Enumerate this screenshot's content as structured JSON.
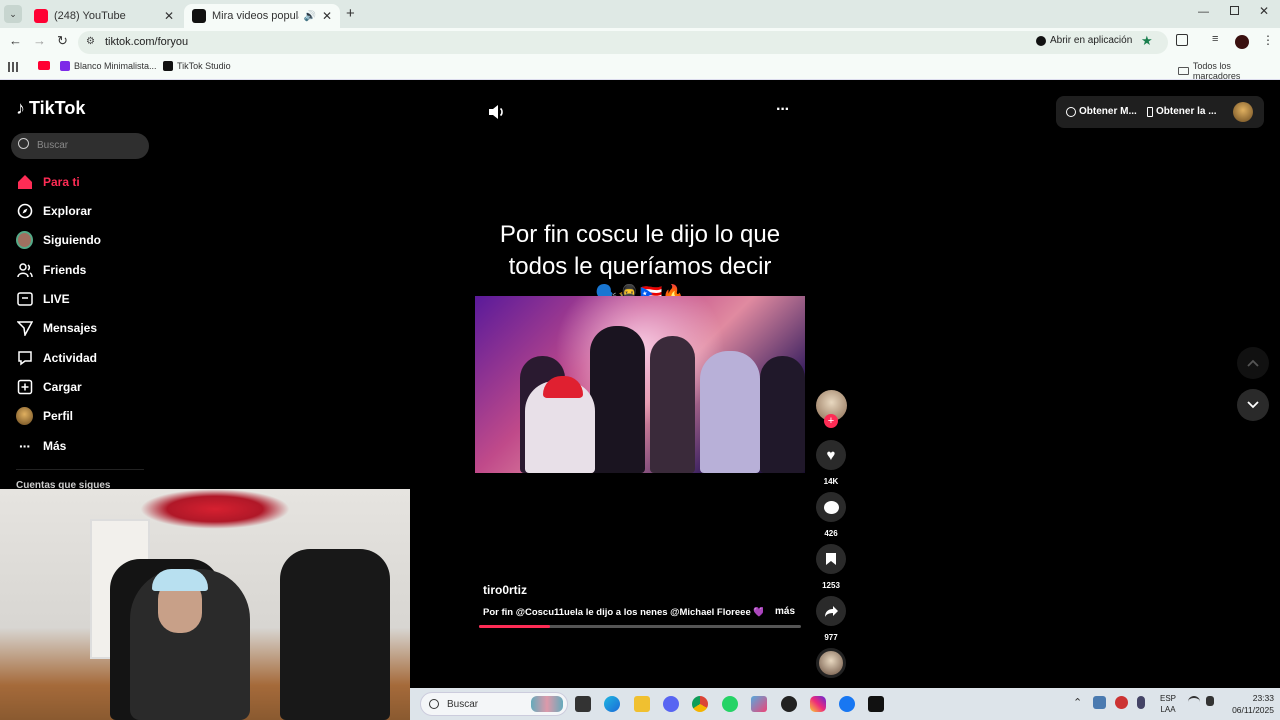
{
  "browser": {
    "tabs": [
      {
        "title": "(248) YouTube"
      },
      {
        "title": "Mira videos populares sele"
      }
    ],
    "url": "tiktok.com/foryou",
    "open_in_app": "Abrir en aplicación",
    "bookmarks": [
      "Blanco Minimalista...",
      "TikTok Studio"
    ],
    "all_bookmarks": "Todos los marcadores"
  },
  "tiktok": {
    "logo": "TikTok",
    "search_placeholder": "Buscar",
    "nav": [
      {
        "label": "Para ti",
        "icon": "home-icon"
      },
      {
        "label": "Explorar",
        "icon": "compass-icon"
      },
      {
        "label": "Siguiendo",
        "icon": "avatar-icon"
      },
      {
        "label": "Friends",
        "icon": "friends-icon"
      },
      {
        "label": "LIVE",
        "icon": "live-icon"
      },
      {
        "label": "Mensajes",
        "icon": "send-icon"
      },
      {
        "label": "Actividad",
        "icon": "inbox-icon"
      },
      {
        "label": "Cargar",
        "icon": "upload-icon"
      },
      {
        "label": "Perfil",
        "icon": "profile-icon"
      },
      {
        "label": "Más",
        "icon": "more-icon"
      }
    ],
    "following_heading": "Cuentas que sigues",
    "top_buttons": {
      "coins": "Obtener M...",
      "app": "Obtener la ..."
    },
    "video": {
      "caption_line1": "Por fin coscu le dijo lo que",
      "caption_line2": "todos le queríamos decir",
      "emojis": "🗣️🥷🇵🇷🔥",
      "author": "tiro0rtiz",
      "description": "Por fin @Coscu11uela le dijo a los nenes @Michael Floreee 💜 ...",
      "more": "más"
    },
    "actions": {
      "likes": "14K",
      "comments": "426",
      "saves": "1253",
      "shares": "977"
    },
    "accent": "#fe2c55"
  },
  "taskbar": {
    "search": "Buscar",
    "lang_top": "ESP",
    "lang_bottom": "LAA",
    "time": "23:33",
    "date": "06/11/2025"
  }
}
